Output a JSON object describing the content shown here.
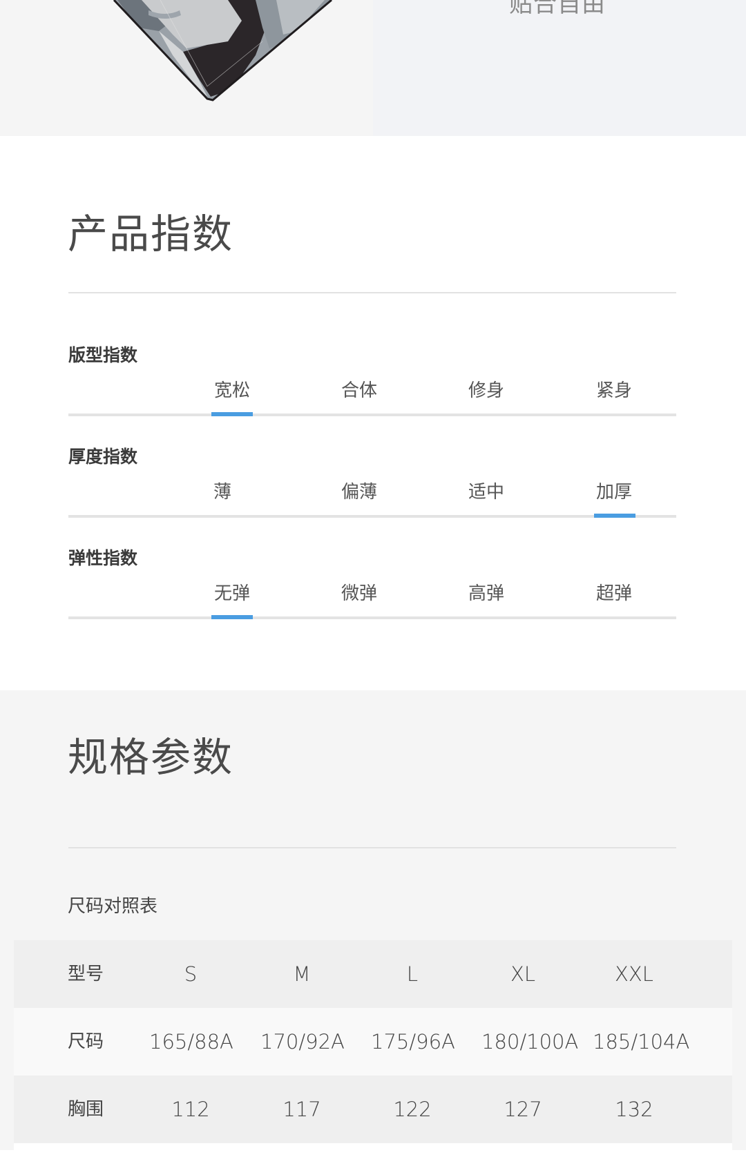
{
  "hero": {
    "caption": "贴合自由",
    "image": "camouflage-garment-hem"
  },
  "product_index": {
    "title": "产品指数",
    "accent_color": "#4a9de1",
    "metrics": [
      {
        "label": "版型指数",
        "options": [
          "宽松",
          "合体",
          "修身",
          "紧身"
        ],
        "selected": "宽松",
        "selected_index": 0
      },
      {
        "label": "厚度指数",
        "options": [
          "薄",
          "偏薄",
          "适中",
          "加厚"
        ],
        "selected": "加厚",
        "selected_index": 3
      },
      {
        "label": "弹性指数",
        "options": [
          "无弹",
          "微弹",
          "高弹",
          "超弹"
        ],
        "selected": "无弹",
        "selected_index": 0
      }
    ]
  },
  "specs": {
    "title": "规格参数",
    "table_caption": "尺码对照表",
    "columns": [
      "型号",
      "S",
      "M",
      "L",
      "XL",
      "XXL"
    ],
    "rows": [
      [
        "尺码",
        "165/88A",
        "170/92A",
        "175/96A",
        "180/100A",
        "185/104A"
      ],
      [
        "胸围",
        "112",
        "117",
        "122",
        "127",
        "132"
      ]
    ]
  }
}
